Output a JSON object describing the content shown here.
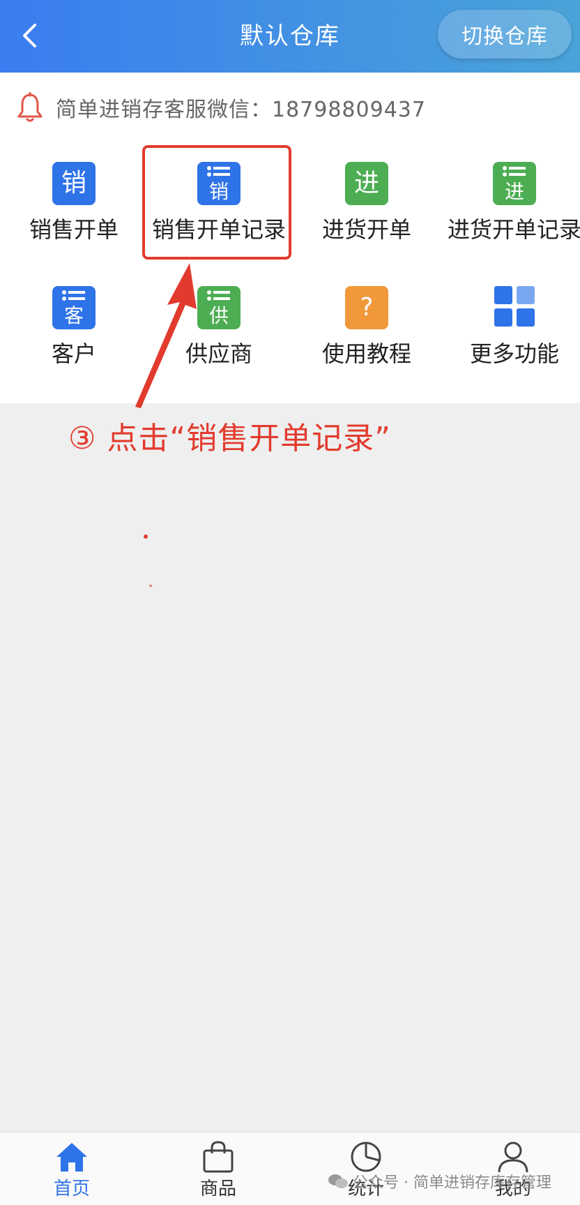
{
  "header": {
    "title": "默认仓库",
    "switch_label": "切换仓库"
  },
  "notice": {
    "text": "简单进销存客服微信：18798809437"
  },
  "grid": {
    "sales_order": {
      "icon_char": "销",
      "label": "销售开单"
    },
    "sales_records": {
      "icon_char": "销",
      "label": "销售开单记录"
    },
    "purchase_order": {
      "icon_char": "进",
      "label": "进货开单"
    },
    "purchase_records": {
      "icon_char": "进",
      "label": "进货开单记录"
    },
    "customers": {
      "icon_char": "客",
      "label": "客户"
    },
    "suppliers": {
      "icon_char": "供",
      "label": "供应商"
    },
    "tutorial": {
      "icon_char": "?",
      "label": "使用教程"
    },
    "more": {
      "label": "更多功能"
    }
  },
  "annotation": {
    "text": "③ 点击“销售开单记录”"
  },
  "tabbar": {
    "home": "首页",
    "goods": "商品",
    "stats": "统计",
    "mine": "我的"
  },
  "watermark": {
    "text": "公众号 · 简单进销存库存管理"
  },
  "colors": {
    "header_start": "#3a7df0",
    "header_end": "#4aa3d8",
    "tile_blue": "#2f73e8",
    "tile_green": "#4cad52",
    "tile_orange": "#f0983a",
    "annotation_red": "#e23b2e",
    "active_tab": "#2f73e8"
  },
  "icons": {
    "back": "chevron-left-icon",
    "notice": "bell-icon",
    "more": "grid-squares-icon",
    "home": "home-icon",
    "goods": "shopping-bag-icon",
    "stats": "pie-chart-icon",
    "mine": "user-icon"
  }
}
